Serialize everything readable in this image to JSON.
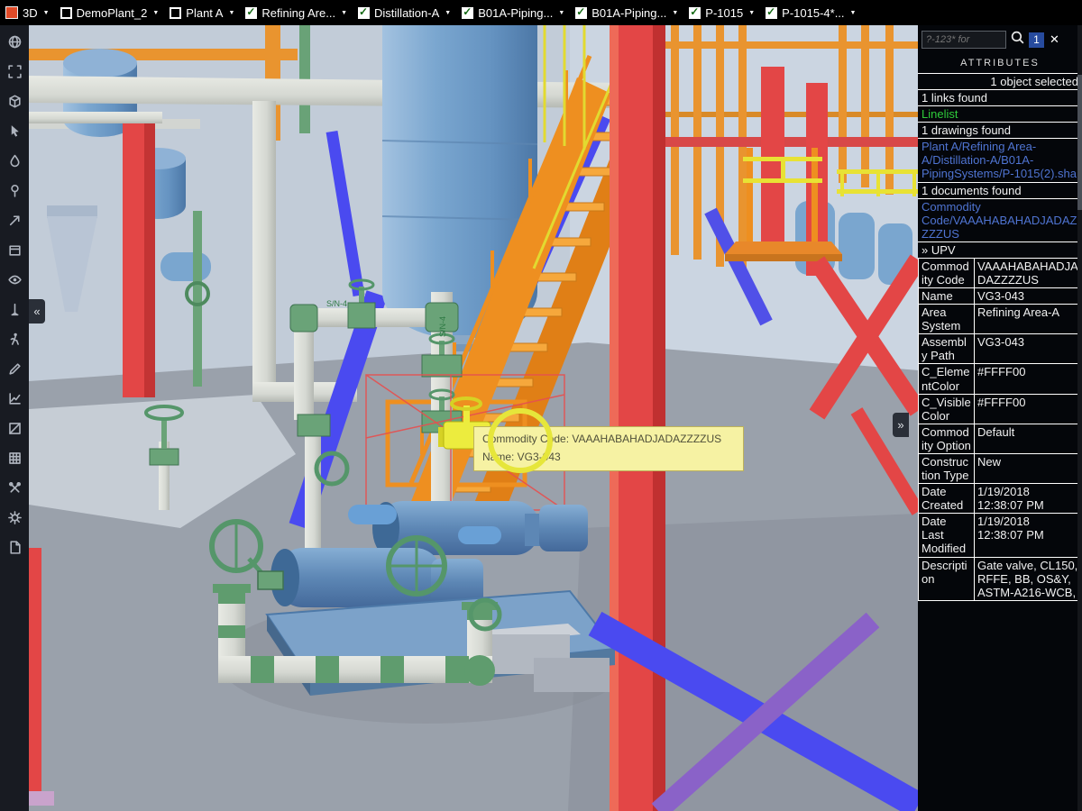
{
  "topbar": {
    "caret": "▼",
    "items": [
      {
        "label": "3D",
        "icon": "model-icon"
      },
      {
        "label": "DemoPlant_2",
        "icon": "window-icon"
      },
      {
        "label": "Plant A",
        "icon": "window-icon"
      },
      {
        "label": "Refining Are...",
        "checked": true
      },
      {
        "label": "Distillation-A",
        "checked": true
      },
      {
        "label": "B01A-Piping...",
        "checked": true
      },
      {
        "label": "B01A-Piping...",
        "checked": true
      },
      {
        "label": "P-1015",
        "checked": true
      },
      {
        "label": "P-1015-4*...",
        "checked": true
      }
    ]
  },
  "left_toolbar": {
    "collapse_label": "«",
    "icons": [
      "globe",
      "fit-screen",
      "cube",
      "pointer",
      "paint-drop",
      "pin",
      "cursor-ne",
      "box",
      "eye",
      "measure",
      "walk",
      "pencil",
      "chart",
      "section-plane",
      "grid",
      "tools",
      "gear",
      "document"
    ]
  },
  "viewport": {
    "expand_label": "»",
    "pipe_label": "S/N-4",
    "tooltip": {
      "line1": "Commodity Code: VAAAHABAHADJADAZZZZUS",
      "line2": "Name: VG3-043"
    }
  },
  "panel": {
    "search": {
      "placeholder": "?-123* for",
      "badge": "1",
      "close_icon": "✕"
    },
    "title": "ATTRIBUTES",
    "info": [
      {
        "text": "1 object selected",
        "style": "plain"
      },
      {
        "text": "1 links found",
        "style": "plain"
      },
      {
        "text": "Linelist",
        "style": "green-link"
      },
      {
        "text": "1 drawings found",
        "style": "plain"
      },
      {
        "text": "Plant A/Refining Area-A/Distillation-A/B01A-PipingSystems/P-1015(2).sha",
        "style": "blue-link"
      },
      {
        "text": "1 documents found",
        "style": "plain"
      },
      {
        "text": "Commodity Code/VAAAHABAHADJADAZZZZUS",
        "style": "blue-link"
      },
      {
        "text": "» UPV",
        "style": "plain"
      }
    ],
    "attributes": {
      "rows": [
        {
          "label": "Commodity Code",
          "value": "VAAAHABAHADJADAZZZZUS"
        },
        {
          "label": "Name",
          "value": "VG3-043"
        },
        {
          "label": "Area System",
          "value": "Refining Area-A"
        },
        {
          "label": "Assembly Path",
          "value": "VG3-043"
        },
        {
          "label": "C_ElementColor",
          "value": "#FFFF00"
        },
        {
          "label": "C_VisibleColor",
          "value": "#FFFF00"
        },
        {
          "label": "Commodity Option",
          "value": "Default"
        },
        {
          "label": "Construction Type",
          "value": "New"
        },
        {
          "label": "Date Created",
          "value": "1/19/2018 12:38:07 PM"
        },
        {
          "label": "Date Last Modified",
          "value": "1/19/2018 12:38:07 PM"
        },
        {
          "label": "Description",
          "value": "Gate valve, CL150, RFFE, BB, OS&Y, ASTM-A216-WCB,"
        }
      ]
    }
  },
  "colors": {
    "highlight_yellow": "#FFFF00",
    "selection_wireframe": "#E65050",
    "link_blue": "#4F74D2",
    "linelist_green": "#2ECC3A",
    "steel_red": "#E34646",
    "steel_orange": "#EE8F20"
  }
}
